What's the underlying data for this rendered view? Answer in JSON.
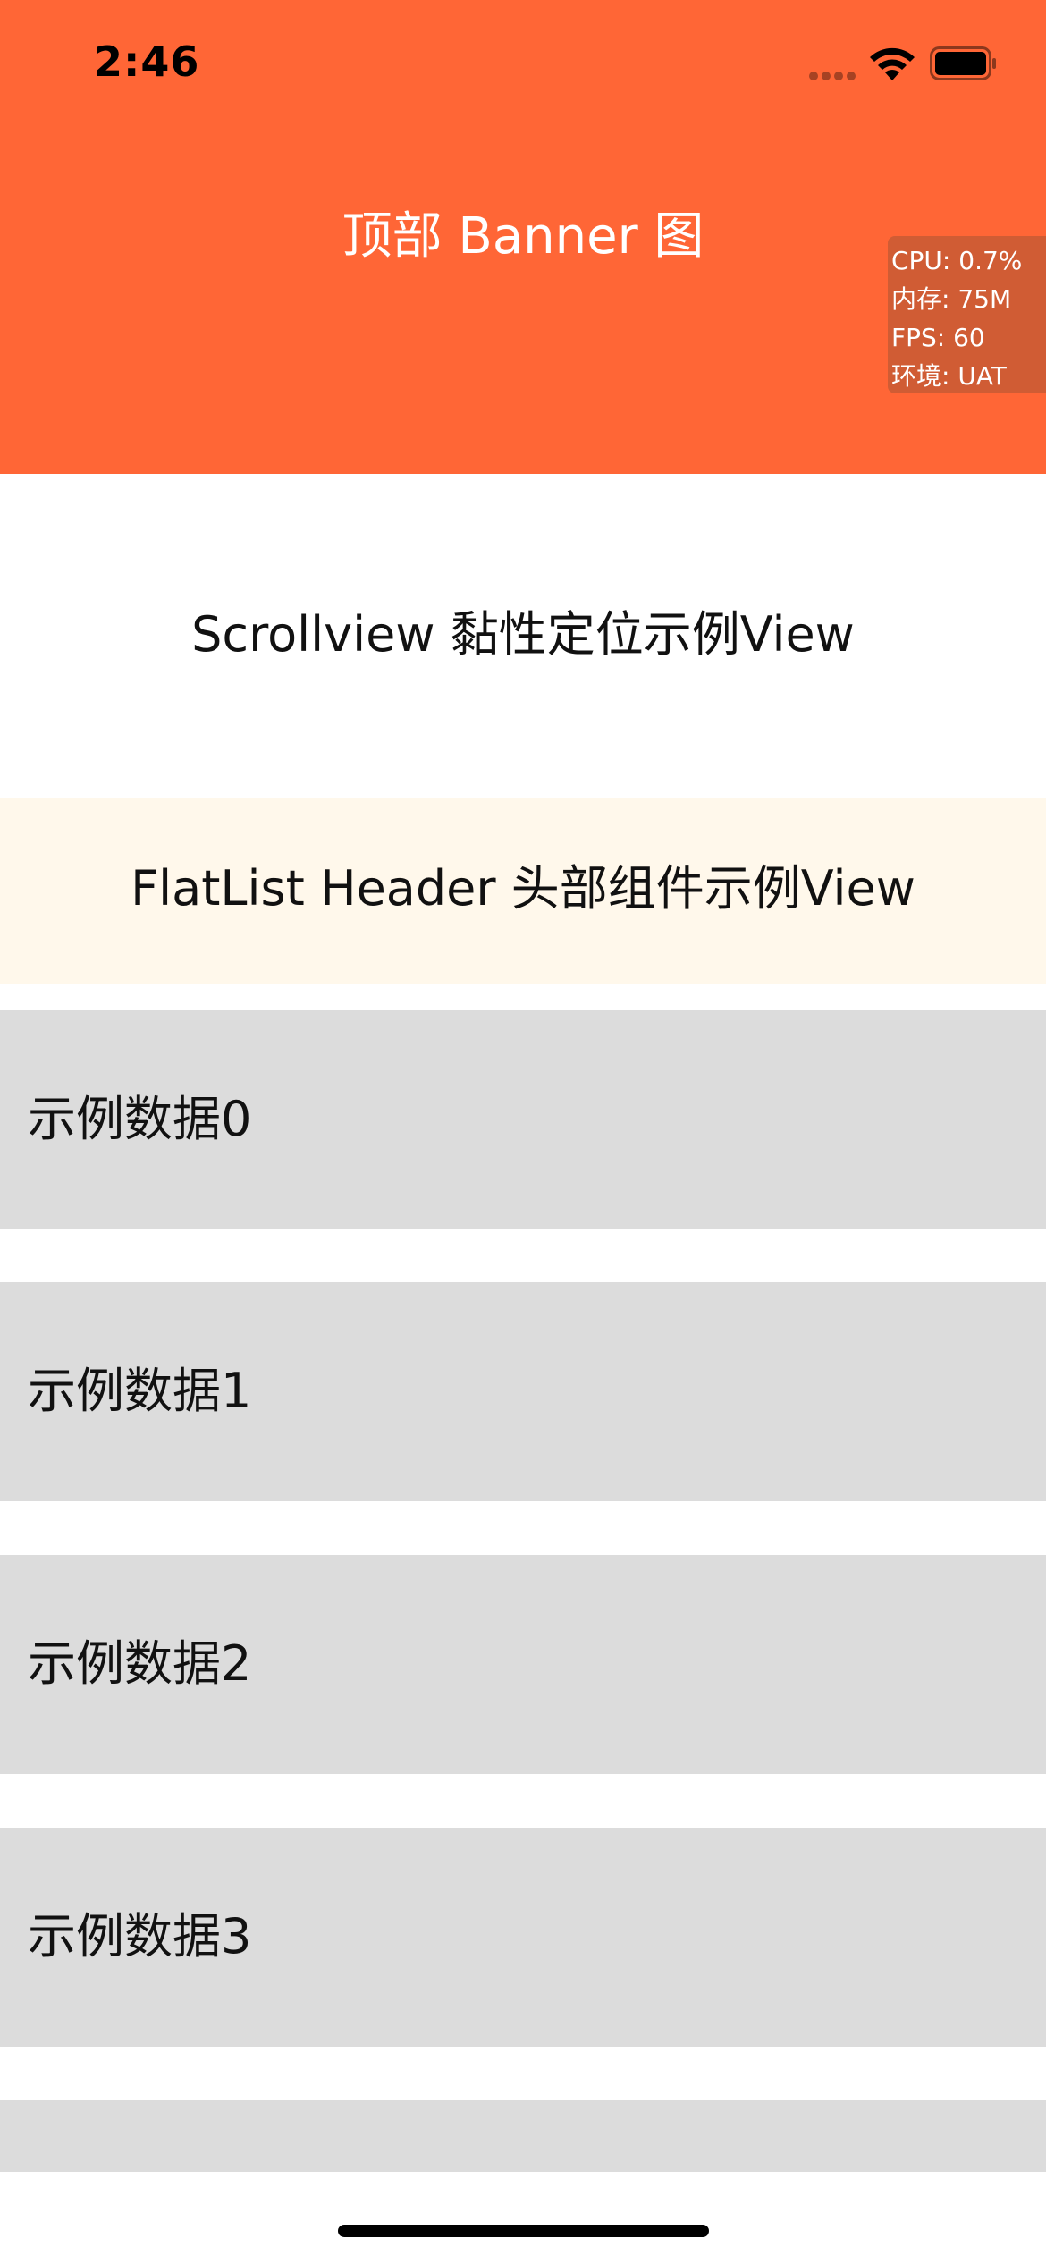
{
  "status_bar": {
    "time": "2:46",
    "icons": [
      "signal-dots-icon",
      "wifi-icon",
      "battery-icon"
    ]
  },
  "banner": {
    "title": "顶部 Banner 图",
    "color": "#FF6636"
  },
  "perf_monitor": {
    "cpu": "CPU: 0.7%",
    "memory": "内存: 75M",
    "fps": "FPS: 60",
    "env": "环境: UAT"
  },
  "sticky_view": {
    "text": "Scrollview 黏性定位示例View"
  },
  "flatlist_header": {
    "text": "FlatList Header 头部组件示例View",
    "color": "#FFF8EB"
  },
  "list": {
    "item_color": "#DCDCDC",
    "items": [
      {
        "label": "示例数据0"
      },
      {
        "label": "示例数据1"
      },
      {
        "label": "示例数据2"
      },
      {
        "label": "示例数据3"
      },
      {
        "label": ""
      }
    ]
  }
}
